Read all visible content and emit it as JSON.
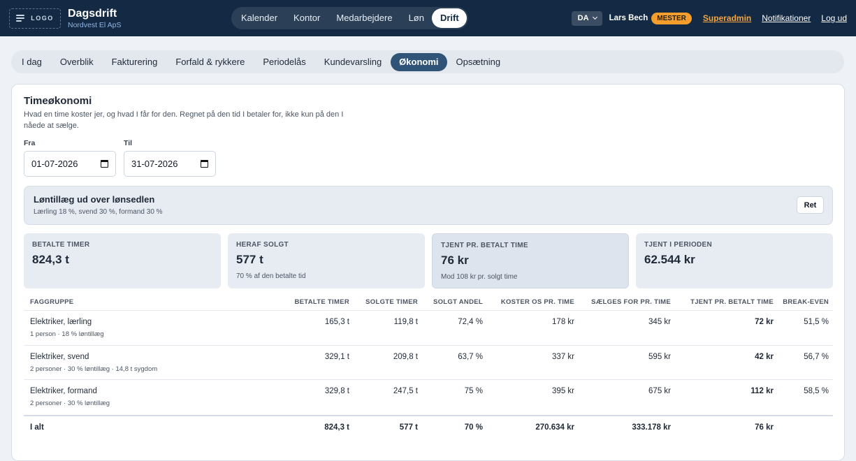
{
  "header": {
    "logo_text": "LOGO",
    "title": "Dagsdrift",
    "subtitle": "Nordvest El ApS",
    "nav": [
      {
        "label": "Kalender"
      },
      {
        "label": "Kontor"
      },
      {
        "label": "Medarbejdere"
      },
      {
        "label": "Løn"
      },
      {
        "label": "Drift",
        "active": true
      }
    ],
    "language": "DA",
    "user_name": "Lars Bech",
    "role": "MESTER",
    "links": {
      "superadmin": "Superadmin",
      "notifications": "Notifikationer",
      "logout": "Log ud"
    }
  },
  "subnav": [
    {
      "label": "I dag"
    },
    {
      "label": "Overblik"
    },
    {
      "label": "Fakturering"
    },
    {
      "label": "Forfald & rykkere"
    },
    {
      "label": "Periodelås"
    },
    {
      "label": "Kundevarsling"
    },
    {
      "label": "Økonomi",
      "active": true
    },
    {
      "label": "Opsætning"
    }
  ],
  "card": {
    "title": "Timeøkonomi",
    "description": "Hvad en time koster jer, og hvad I får for den. Regnet på den tid I betaler for, ikke kun på den I nåede at sælge.",
    "from_label": "Fra",
    "from_value": "01-07-2026",
    "to_label": "Til",
    "to_value": "31-07-2026"
  },
  "lontillaeg": {
    "title": "Løntillæg ud over lønsedlen",
    "sub": "Lærling 18 %, svend 30 %, formand 30 %",
    "button": "Ret"
  },
  "stats": [
    {
      "label": "BETALTE TIMER",
      "value": "824,3 t",
      "sub": ""
    },
    {
      "label": "HERAF SOLGT",
      "value": "577 t",
      "sub": "70 % af den betalte tid"
    },
    {
      "label": "TJENT PR. BETALT TIME",
      "value": "76 kr",
      "sub": "Mod 108 kr pr. solgt time"
    },
    {
      "label": "TJENT I PERIODEN",
      "value": "62.544 kr",
      "sub": ""
    }
  ],
  "table": {
    "headers": [
      "FAGGRUPPE",
      "BETALTE TIMER",
      "SOLGTE TIMER",
      "SOLGT ANDEL",
      "KOSTER OS PR. TIME",
      "SÆLGES FOR PR. TIME",
      "TJENT PR. BETALT TIME",
      "BREAK-EVEN"
    ],
    "rows": [
      {
        "name": "Elektriker, lærling",
        "detail": "1 person · 18 % løntillæg",
        "betalte": "165,3 t",
        "solgte": "119,8 t",
        "andel": "72,4 %",
        "koster": "178 kr",
        "saelges": "345 kr",
        "tjent": "72 kr",
        "breakeven": "51,5 %"
      },
      {
        "name": "Elektriker, svend",
        "detail": "2 personer · 30 % løntillæg · 14,8 t sygdom",
        "betalte": "329,1 t",
        "solgte": "209,8 t",
        "andel": "63,7 %",
        "koster": "337 kr",
        "saelges": "595 kr",
        "tjent": "42 kr",
        "breakeven": "56,7 %"
      },
      {
        "name": "Elektriker, formand",
        "detail": "2 personer · 30 % løntillæg",
        "betalte": "329,8 t",
        "solgte": "247,5 t",
        "andel": "75 %",
        "koster": "395 kr",
        "saelges": "675 kr",
        "tjent": "112 kr",
        "breakeven": "58,5 %"
      }
    ],
    "total": {
      "name": "I alt",
      "betalte": "824,3 t",
      "solgte": "577 t",
      "andel": "70 %",
      "koster": "270.634 kr",
      "saelges": "333.178 kr",
      "tjent": "76 kr",
      "breakeven": ""
    }
  },
  "colors": {
    "topbar": "#142a44",
    "accent": "#f5a540",
    "active_tab": "#2f5478"
  }
}
